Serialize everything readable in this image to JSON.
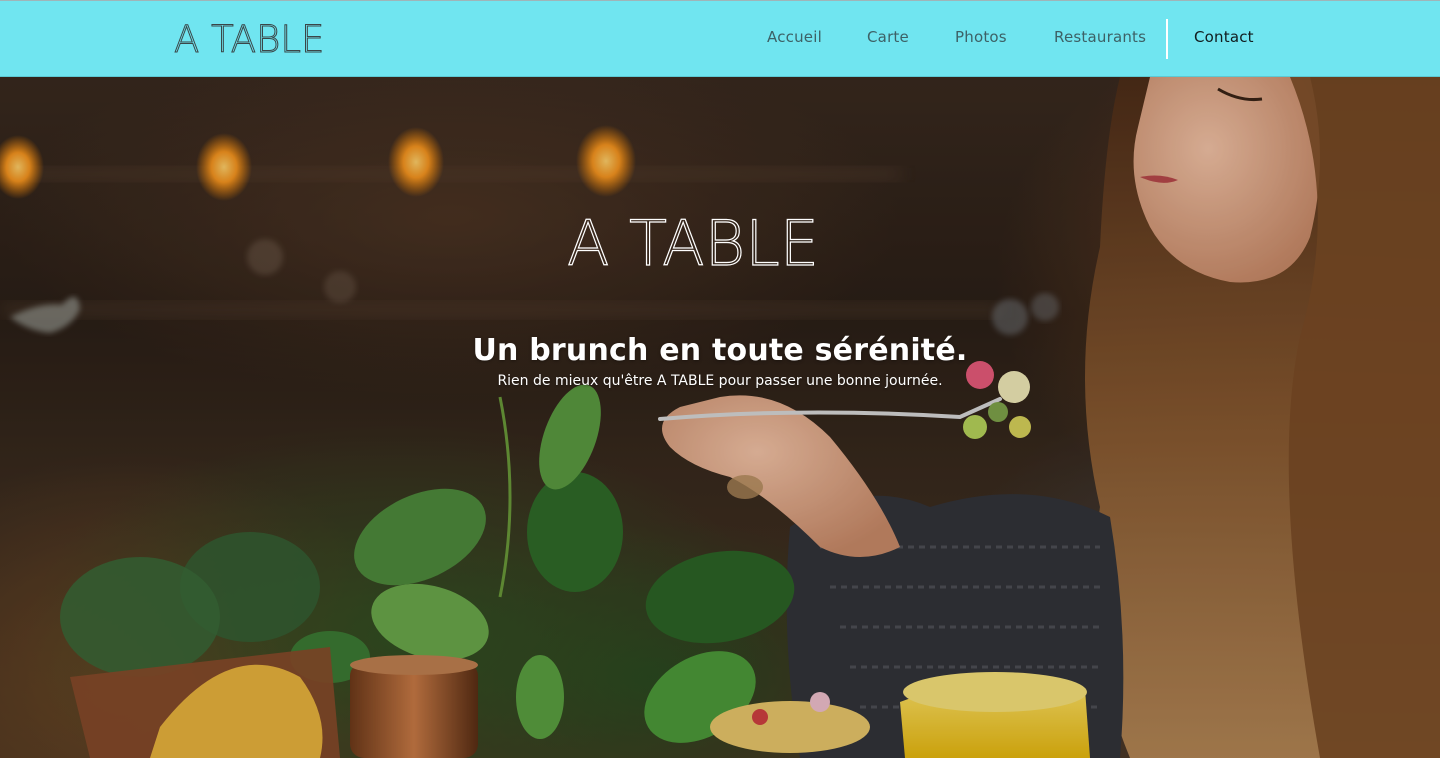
{
  "header": {
    "logo_text": "A TABLE",
    "background_color": "#70e5f0",
    "nav": [
      {
        "label": "Accueil"
      },
      {
        "label": "Carte"
      },
      {
        "label": "Photos"
      },
      {
        "label": "Restaurants"
      },
      {
        "label": "Contact",
        "active": true
      }
    ]
  },
  "hero": {
    "logo_text": "A TABLE",
    "title": "Un brunch en toute sérénité.",
    "subtitle": "Rien de mieux qu'être A TABLE pour passer une bonne journée.",
    "background_image": "woman-eating-brunch-photo"
  }
}
